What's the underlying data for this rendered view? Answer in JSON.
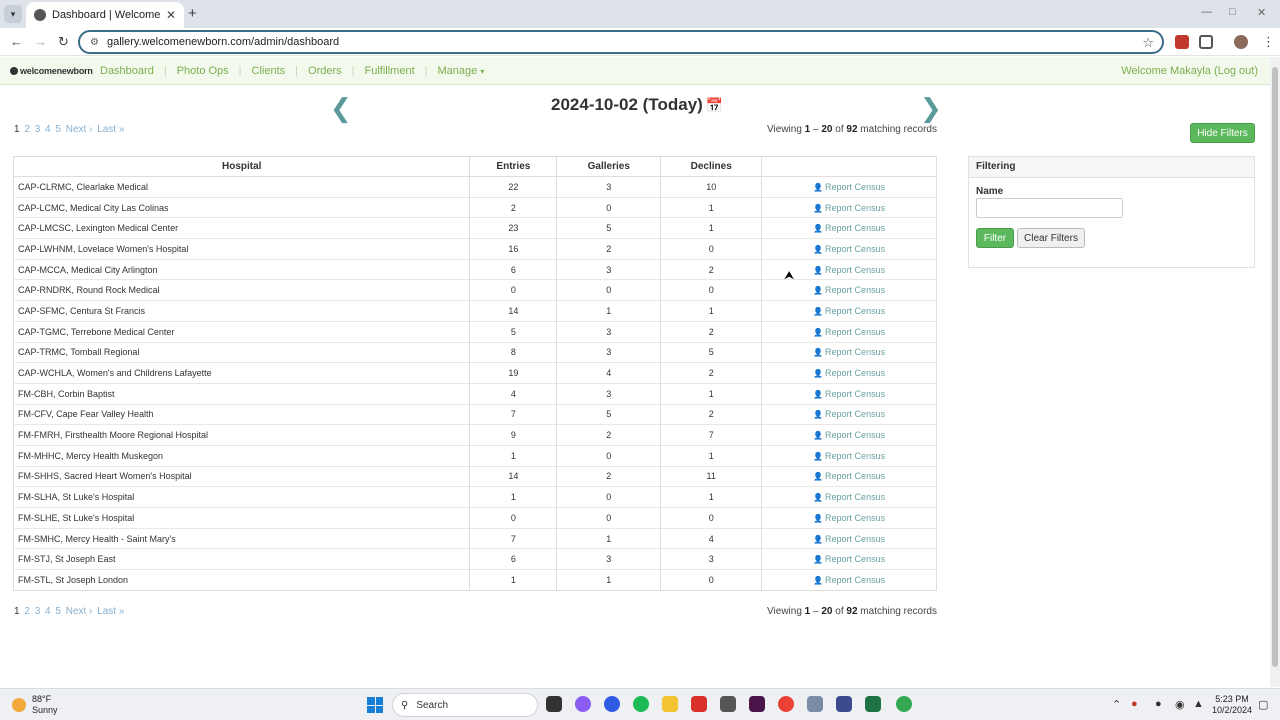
{
  "browser": {
    "tab_title": "Dashboard | WelcomeNewborn",
    "url": "gallery.welcomenewborn.com/admin/dashboard"
  },
  "site": {
    "logo_text": "welcomenewborn",
    "nav": [
      "Dashboard",
      "Photo Ops",
      "Clients",
      "Orders",
      "Fulfillment",
      "Manage"
    ],
    "welcome_text": "Welcome Makayla (Log out)"
  },
  "date_title": "2024-10-02 (Today)",
  "pagination": {
    "current": "1",
    "pages": [
      "2",
      "3",
      "4",
      "5"
    ],
    "next": "Next ›",
    "last": "Last »"
  },
  "viewing": {
    "prefix": "Viewing",
    "from": "1",
    "dash": "–",
    "to": "20",
    "of": "of",
    "total": "92",
    "suffix": "matching records"
  },
  "hide_filters_label": "Hide Filters",
  "table": {
    "headers": [
      "Hospital",
      "Entries",
      "Galleries",
      "Declines",
      ""
    ],
    "action_label": "Report Census",
    "rows": [
      {
        "hospital": "CAP-CLRMC, Clearlake Medical",
        "entries": "22",
        "galleries": "3",
        "declines": "10"
      },
      {
        "hospital": "CAP-LCMC, Medical City Las Colinas",
        "entries": "2",
        "galleries": "0",
        "declines": "1"
      },
      {
        "hospital": "CAP-LMCSC, Lexington Medical Center",
        "entries": "23",
        "galleries": "5",
        "declines": "1"
      },
      {
        "hospital": "CAP-LWHNM, Lovelace Women's Hospital",
        "entries": "16",
        "galleries": "2",
        "declines": "0"
      },
      {
        "hospital": "CAP-MCCA, Medical City Arlington",
        "entries": "6",
        "galleries": "3",
        "declines": "2"
      },
      {
        "hospital": "CAP-RNDRK, Round Rock Medical",
        "entries": "0",
        "galleries": "0",
        "declines": "0"
      },
      {
        "hospital": "CAP-SFMC, Centura St Francis",
        "entries": "14",
        "galleries": "1",
        "declines": "1"
      },
      {
        "hospital": "CAP-TGMC, Terrebone Medical Center",
        "entries": "5",
        "galleries": "3",
        "declines": "2"
      },
      {
        "hospital": "CAP-TRMC, Tomball Regional",
        "entries": "8",
        "galleries": "3",
        "declines": "5"
      },
      {
        "hospital": "CAP-WCHLA, Women's and Childrens Lafayette",
        "entries": "19",
        "galleries": "4",
        "declines": "2"
      },
      {
        "hospital": "FM-CBH, Corbin Baptist",
        "entries": "4",
        "galleries": "3",
        "declines": "1"
      },
      {
        "hospital": "FM-CFV, Cape Fear Valley Health",
        "entries": "7",
        "galleries": "5",
        "declines": "2"
      },
      {
        "hospital": "FM-FMRH, Firsthealth Moore Regional Hospital",
        "entries": "9",
        "galleries": "2",
        "declines": "7"
      },
      {
        "hospital": "FM-MHHC, Mercy Health Muskegon",
        "entries": "1",
        "galleries": "0",
        "declines": "1"
      },
      {
        "hospital": "FM-SHHS, Sacred Heart Women's Hospital",
        "entries": "14",
        "galleries": "2",
        "declines": "11"
      },
      {
        "hospital": "FM-SLHA, St Luke's Hospital",
        "entries": "1",
        "galleries": "0",
        "declines": "1"
      },
      {
        "hospital": "FM-SLHE, St Luke's Hospital",
        "entries": "0",
        "galleries": "0",
        "declines": "0"
      },
      {
        "hospital": "FM-SMHC, Mercy Health - Saint Mary's",
        "entries": "7",
        "galleries": "1",
        "declines": "4"
      },
      {
        "hospital": "FM-STJ, St Joseph East",
        "entries": "6",
        "galleries": "3",
        "declines": "3"
      },
      {
        "hospital": "FM-STL, St Joseph London",
        "entries": "1",
        "galleries": "1",
        "declines": "0"
      }
    ]
  },
  "filter_panel": {
    "title": "Filtering",
    "name_label": "Name",
    "name_value": "",
    "filter_button": "Filter",
    "clear_button": "Clear Filters"
  },
  "taskbar": {
    "temp": "88°F",
    "condition": "Sunny",
    "search_placeholder": "Search",
    "time": "5:23 PM",
    "date": "10/2/2024"
  },
  "colors": {
    "brand_green": "#7aae4f",
    "button_green": "#5cb85c",
    "link_teal": "#6aa1a1"
  }
}
